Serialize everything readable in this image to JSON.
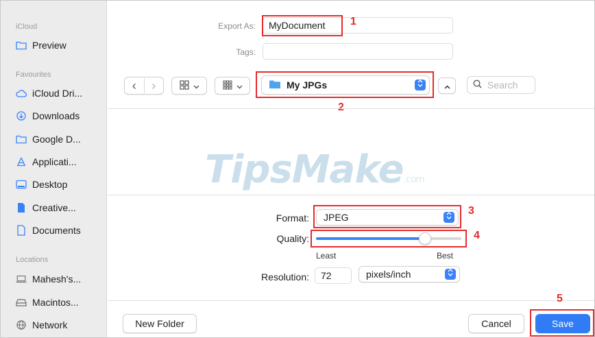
{
  "sidebar": {
    "sections": [
      {
        "title": "iCloud",
        "items": [
          {
            "label": "Preview",
            "icon": "folder-icon"
          }
        ]
      },
      {
        "title": "Favourites",
        "items": [
          {
            "label": "iCloud Dri...",
            "icon": "cloud-icon"
          },
          {
            "label": "Downloads",
            "icon": "download-icon"
          },
          {
            "label": "Google D...",
            "icon": "folder-icon"
          },
          {
            "label": "Applicati...",
            "icon": "applications-icon"
          },
          {
            "label": "Desktop",
            "icon": "desktop-icon"
          },
          {
            "label": "Creative...",
            "icon": "file-icon"
          },
          {
            "label": "Documents",
            "icon": "document-icon"
          }
        ]
      },
      {
        "title": "Locations",
        "items": [
          {
            "label": "Mahesh's...",
            "icon": "laptop-icon"
          },
          {
            "label": "Macintos...",
            "icon": "disk-icon"
          },
          {
            "label": "Network",
            "icon": "network-icon"
          }
        ]
      }
    ]
  },
  "export": {
    "export_as_label": "Export As:",
    "filename": "MyDocument",
    "tags_label": "Tags:",
    "tags_value": ""
  },
  "toolbar": {
    "back": "‹",
    "forward": "›",
    "view_grid": "⊞",
    "view_chevron": "⌄",
    "group": "⠿",
    "location": "My JPGs",
    "expand": "⌃",
    "search_placeholder": "Search"
  },
  "watermark": {
    "main": "TipsMake",
    "suffix": ".com"
  },
  "options": {
    "format_label": "Format:",
    "format_value": "JPEG",
    "quality_label": "Quality:",
    "quality_value": 0.75,
    "least_label": "Least",
    "best_label": "Best",
    "resolution_label": "Resolution:",
    "resolution_value": "72",
    "resolution_unit": "pixels/inch"
  },
  "buttons": {
    "new_folder": "New Folder",
    "cancel": "Cancel",
    "save": "Save"
  },
  "callouts": [
    "1",
    "2",
    "3",
    "4",
    "5"
  ],
  "colors": {
    "accent": "#3a82f7",
    "callout": "#e52b2b",
    "save": "#2f7cf6"
  }
}
